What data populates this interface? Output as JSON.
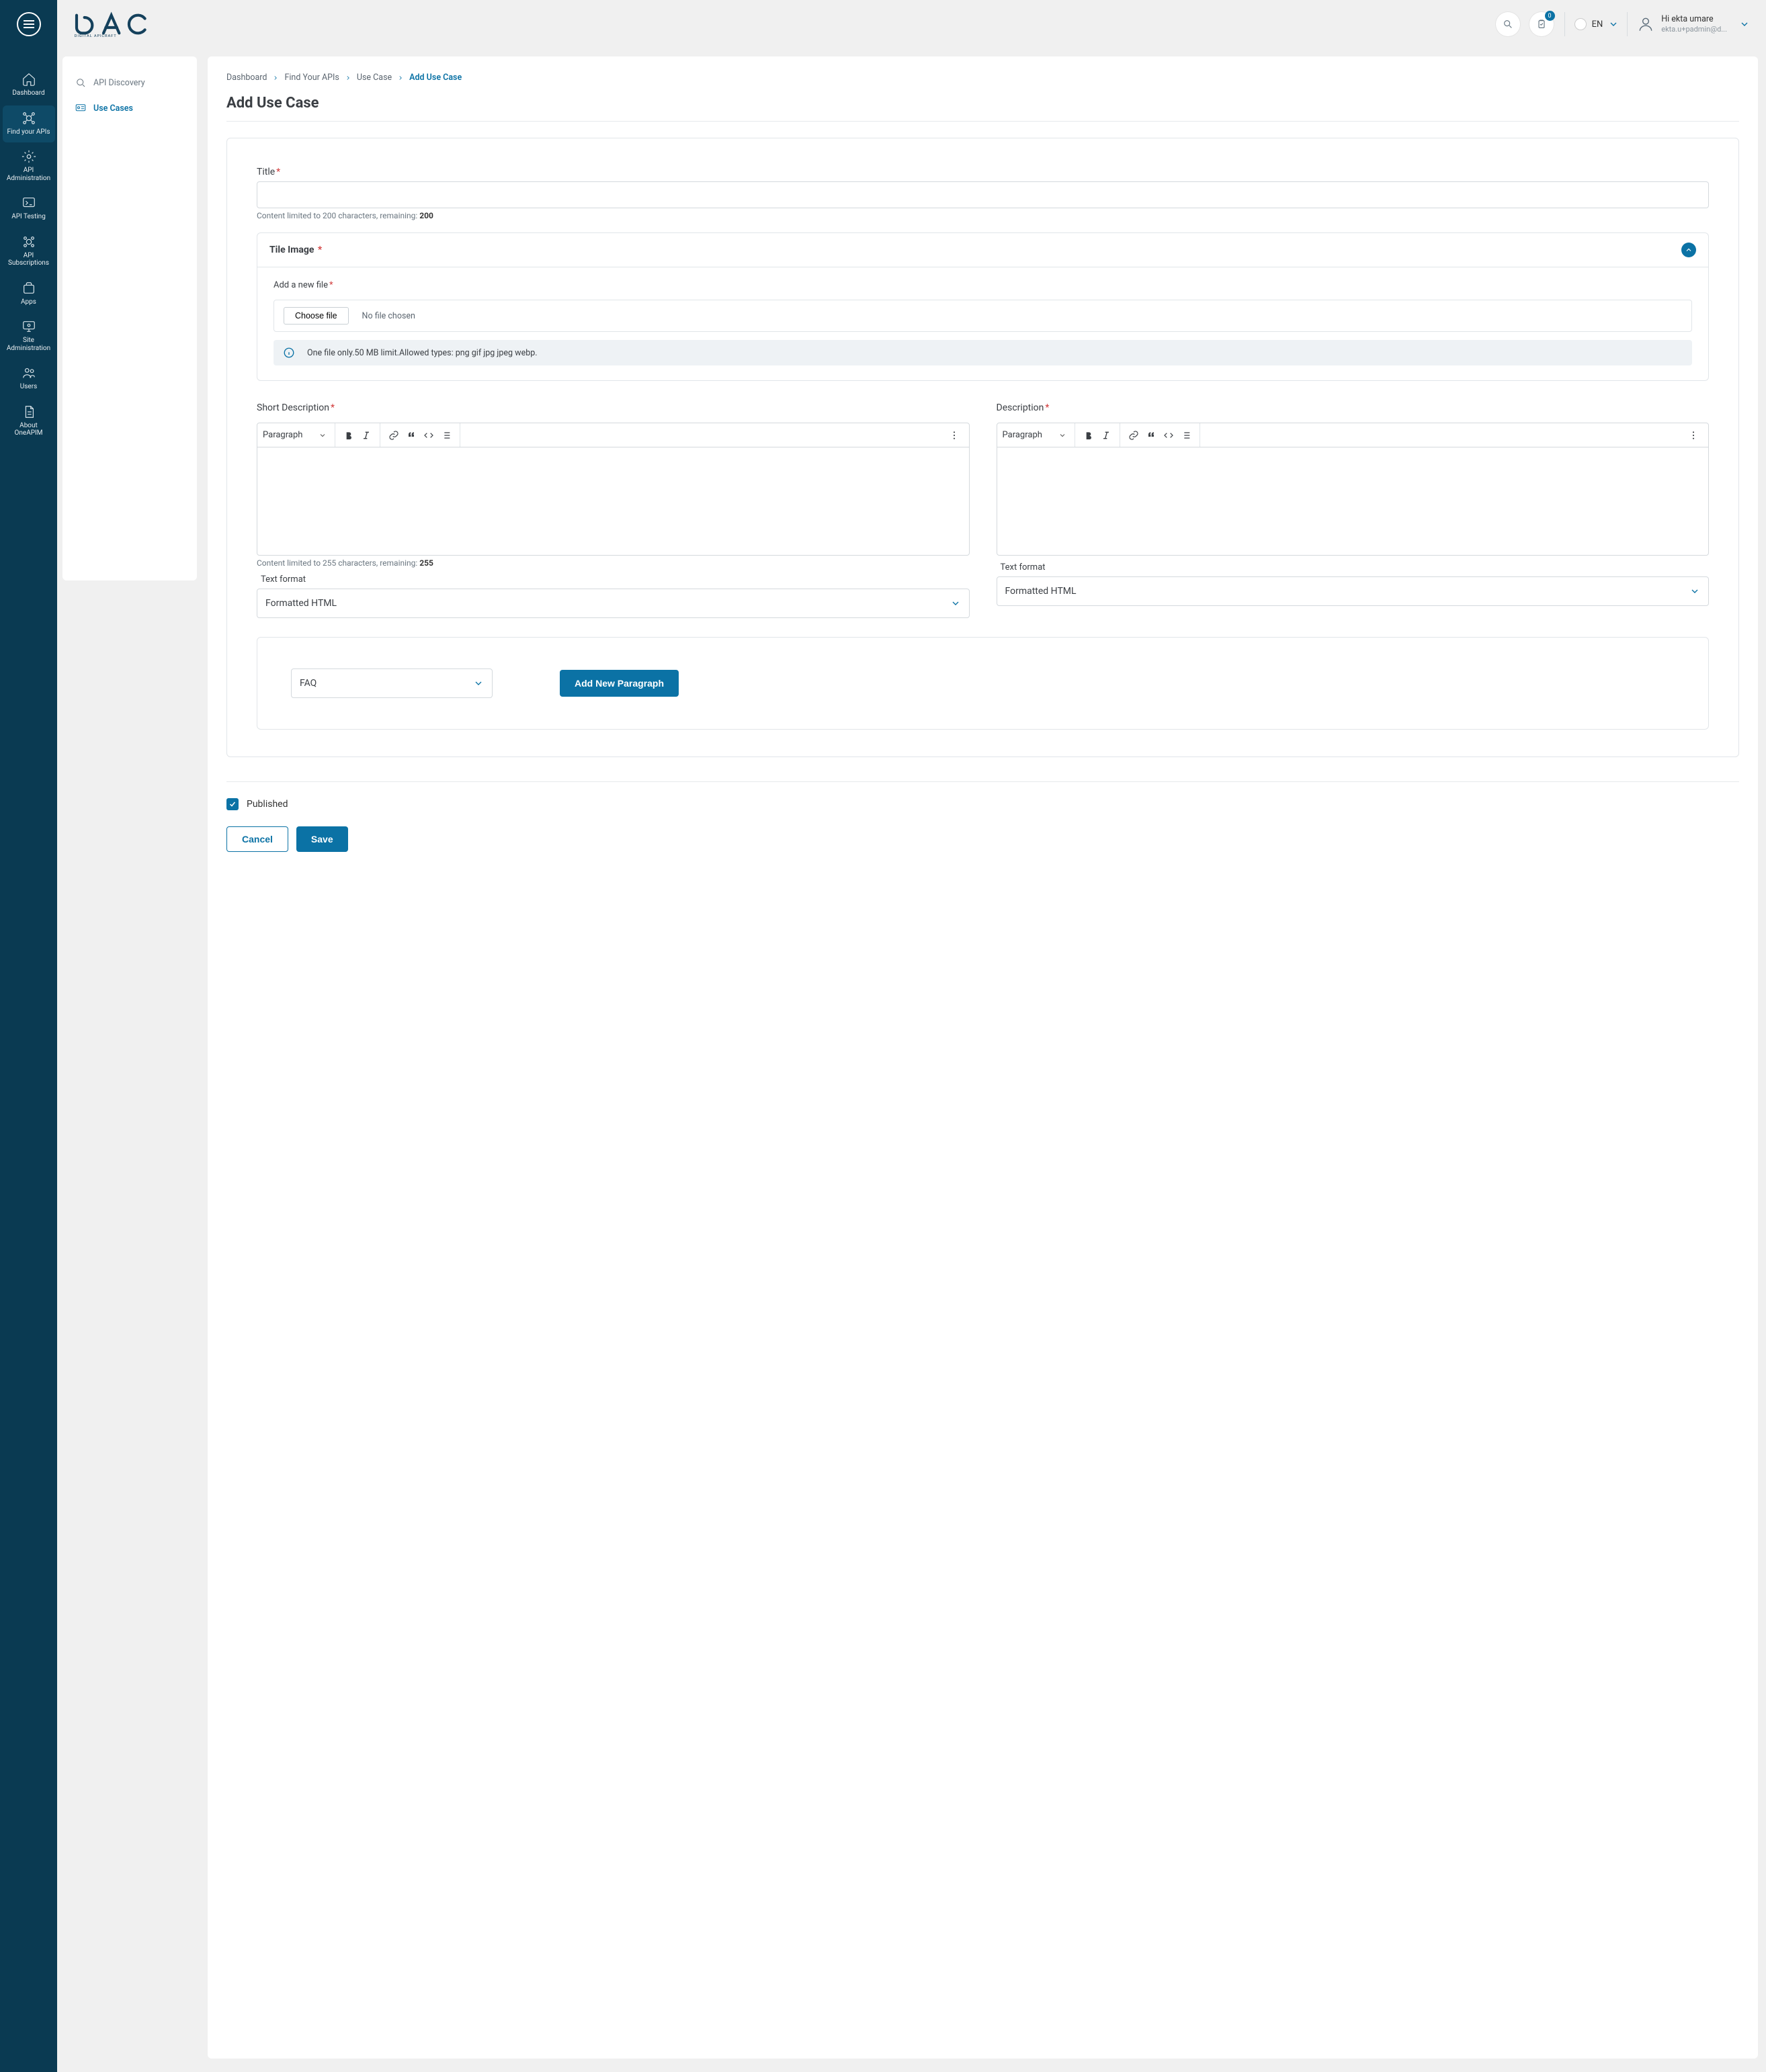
{
  "header": {
    "logo_sub": "DIGITAL APICRAFT",
    "notif_count": "0",
    "lang": "EN",
    "user_hi": "Hi ekta umare",
    "user_email": "ekta.u+padmin@d..."
  },
  "rail": {
    "items": [
      {
        "label": "Dashboard"
      },
      {
        "label": "Find your APIs"
      },
      {
        "label": "API Administration"
      },
      {
        "label": "API Testing"
      },
      {
        "label": "API Subscriptions"
      },
      {
        "label": "Apps"
      },
      {
        "label": "Site Administration"
      },
      {
        "label": "Users"
      },
      {
        "label": "About OneAPIM"
      }
    ]
  },
  "subnav": {
    "items": [
      {
        "label": "API Discovery"
      },
      {
        "label": "Use Cases"
      }
    ]
  },
  "crumbs": {
    "c1": "Dashboard",
    "c2": "Find Your APIs",
    "c3": "Use Case",
    "c4": "Add Use Case"
  },
  "page": {
    "title": "Add Use Case"
  },
  "form": {
    "title_label": "Title",
    "title_helper_pre": "Content limited to 200 characters, remaining: ",
    "title_helper_val": "200",
    "tile_image_label": "Tile Image",
    "add_file_label": "Add a new file",
    "choose_file": "Choose file",
    "no_file": "No file chosen",
    "file_info": "One file only.50 MB limit.Allowed types: png gif jpg jpeg webp.",
    "short_desc_label": "Short Description",
    "desc_label": "Description",
    "style_paragraph": "Paragraph",
    "short_helper_pre": "Content limited to 255 characters, remaining: ",
    "short_helper_val": "255",
    "text_format_label": "Text format",
    "formatted_html": "Formatted HTML",
    "para_select": "FAQ",
    "add_paragraph": "Add New Paragraph",
    "published": "Published",
    "cancel": "Cancel",
    "save": "Save"
  }
}
